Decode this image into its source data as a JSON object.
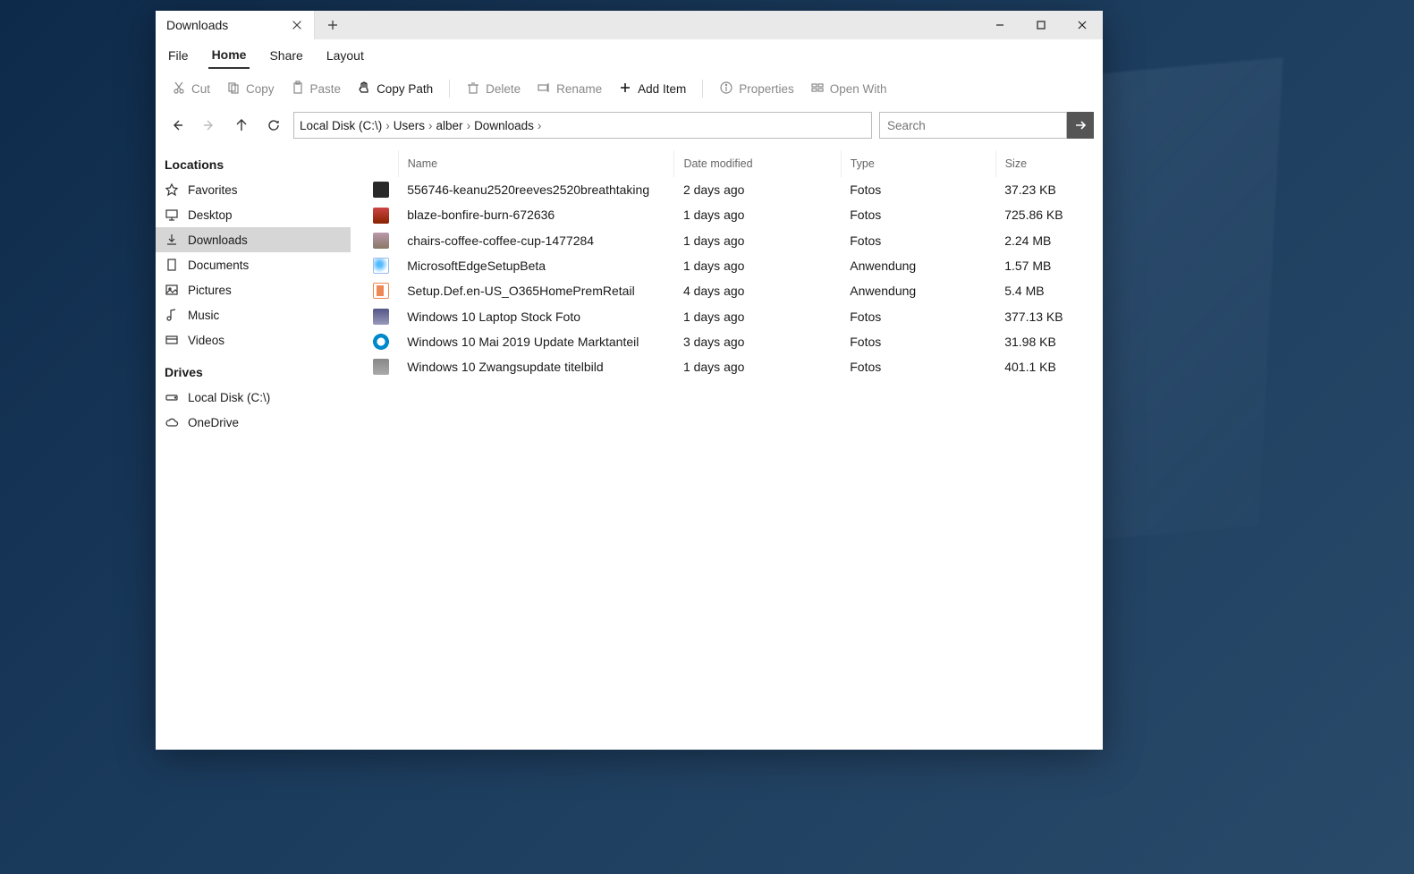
{
  "tab": {
    "title": "Downloads"
  },
  "menu": {
    "items": [
      "File",
      "Home",
      "Share",
      "Layout"
    ],
    "active_index": 1
  },
  "toolbar": {
    "cut": "Cut",
    "copy": "Copy",
    "paste": "Paste",
    "copypath": "Copy Path",
    "delete": "Delete",
    "rename": "Rename",
    "additem": "Add Item",
    "properties": "Properties",
    "openwith": "Open With"
  },
  "breadcrumb": [
    "Local Disk (C:\\)",
    "Users",
    "alber",
    "Downloads"
  ],
  "search": {
    "placeholder": "Search"
  },
  "sidebar": {
    "locations_heading": "Locations",
    "locations": [
      {
        "label": "Favorites",
        "icon": "star"
      },
      {
        "label": "Desktop",
        "icon": "desktop"
      },
      {
        "label": "Downloads",
        "icon": "download",
        "active": true
      },
      {
        "label": "Documents",
        "icon": "document"
      },
      {
        "label": "Pictures",
        "icon": "picture"
      },
      {
        "label": "Music",
        "icon": "music"
      },
      {
        "label": "Videos",
        "icon": "video"
      }
    ],
    "drives_heading": "Drives",
    "drives": [
      {
        "label": "Local Disk (C:\\)",
        "icon": "disk"
      },
      {
        "label": "OneDrive",
        "icon": "cloud"
      }
    ]
  },
  "columns": {
    "name": "Name",
    "date": "Date modified",
    "type": "Type",
    "size": "Size"
  },
  "files": [
    {
      "icon": "ic-dark",
      "name": "556746-keanu2520reeves2520breathtaking",
      "date": "2 days ago",
      "type": "Fotos",
      "size": "37.23 KB"
    },
    {
      "icon": "ic-fire",
      "name": "blaze-bonfire-burn-672636",
      "date": "1 days ago",
      "type": "Fotos",
      "size": "725.86 KB"
    },
    {
      "icon": "ic-chairs",
      "name": "chairs-coffee-coffee-cup-1477284",
      "date": "1 days ago",
      "type": "Fotos",
      "size": "2.24 MB"
    },
    {
      "icon": "ic-edge",
      "name": "MicrosoftEdgeSetupBeta",
      "date": "1 days ago",
      "type": "Anwendung",
      "size": "1.57 MB"
    },
    {
      "icon": "ic-office",
      "name": "Setup.Def.en-US_O365HomePremRetail",
      "date": "4 days ago",
      "type": "Anwendung",
      "size": "5.4 MB"
    },
    {
      "icon": "ic-laptop",
      "name": "Windows 10 Laptop Stock Foto",
      "date": "1 days ago",
      "type": "Fotos",
      "size": "377.13 KB"
    },
    {
      "icon": "ic-ring",
      "name": "Windows 10 Mai 2019 Update Marktanteil",
      "date": "3 days ago",
      "type": "Fotos",
      "size": "31.98 KB"
    },
    {
      "icon": "ic-grid",
      "name": "Windows 10 Zwangsupdate titelbild",
      "date": "1 days ago",
      "type": "Fotos",
      "size": "401.1 KB"
    }
  ]
}
